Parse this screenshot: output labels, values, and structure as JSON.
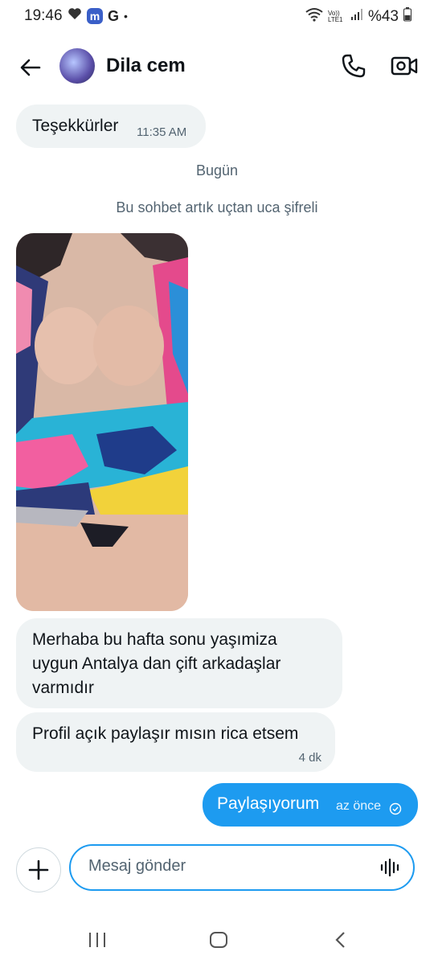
{
  "status_bar": {
    "time": "19:46",
    "app_letter": "m",
    "g_letter": "G",
    "dot": "•",
    "network_label": "Vo)) LTE1",
    "battery": "%43"
  },
  "header": {
    "title": "Dila cem"
  },
  "messages": {
    "first": {
      "text": "Teşekkürler",
      "time": "11:35 AM"
    },
    "date_separator": "Bugün",
    "encryption_note": "Bu sohbet artık uçtan uca şifreli",
    "msg2": {
      "lines": [
        "Merhaba bu hafta sonu yaşımiza",
        "uygun Antalya dan çift arkadaşlar",
        "varmıdır"
      ]
    },
    "msg3": {
      "text": "Profil açık paylaşır mısın rica etsem",
      "time": "4 dk"
    },
    "sent": {
      "text": "Paylaşıyorum",
      "time": "az önce"
    }
  },
  "composer": {
    "placeholder": "Mesaj gönder"
  },
  "colors": {
    "accent": "#1d9bf0",
    "incoming_bubble": "#eff3f4",
    "muted": "#536471"
  }
}
